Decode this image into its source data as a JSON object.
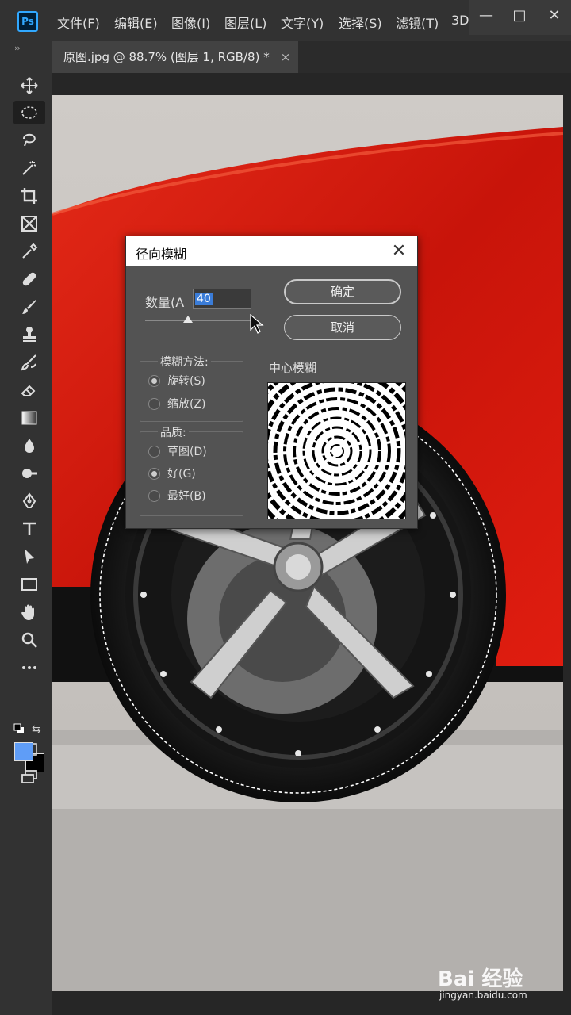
{
  "app": {
    "logo": "Ps"
  },
  "menu": [
    "文件(F)",
    "编辑(E)",
    "图像(I)",
    "图层(L)",
    "文字(Y)",
    "选择(S)",
    "滤镜(T)",
    "3D"
  ],
  "window_controls": {
    "minimize": "—",
    "maximize": "□",
    "close": "✕"
  },
  "tab": {
    "title": "原图.jpg @ 88.7% (图层 1, RGB/8) *",
    "close": "×"
  },
  "toolbar": {
    "collapse": "››",
    "tools": [
      "move-icon",
      "elliptical-marquee-icon",
      "lasso-icon",
      "magic-wand-icon",
      "crop-icon",
      "frame-icon",
      "eyedropper-icon",
      "healing-brush-icon",
      "brush-icon",
      "clone-stamp-icon",
      "history-brush-icon",
      "eraser-icon",
      "gradient-icon",
      "blur-icon",
      "dodge-icon",
      "pen-icon",
      "type-icon",
      "path-selection-icon",
      "rectangle-icon",
      "hand-icon",
      "zoom-icon",
      "more-tools-icon"
    ],
    "active_tool": "elliptical-marquee-icon",
    "foreground_color": "#5f9df7",
    "background_color": "#000000"
  },
  "dialog": {
    "title": "径向模糊",
    "close": "✕",
    "amount_label": "数量(A",
    "amount_value": "40",
    "amount_fraction": 0.4,
    "ok_label": "确定",
    "cancel_label": "取消",
    "blur_method": {
      "label": "模糊方法:",
      "options": [
        {
          "label": "旋转(S)",
          "checked": true
        },
        {
          "label": "缩放(Z)",
          "checked": false
        }
      ]
    },
    "quality": {
      "label": "品质:",
      "options": [
        {
          "label": "草图(D)",
          "checked": false
        },
        {
          "label": "好(G)",
          "checked": true
        },
        {
          "label": "最好(B)",
          "checked": false
        }
      ]
    },
    "center_label": "中心模糊"
  },
  "colors": {
    "car_red": "#d81a0e",
    "accent_blue": "#31a8ff"
  },
  "watermark": {
    "logo": "Bai 经验",
    "url": "jingyan.baidu.com"
  }
}
